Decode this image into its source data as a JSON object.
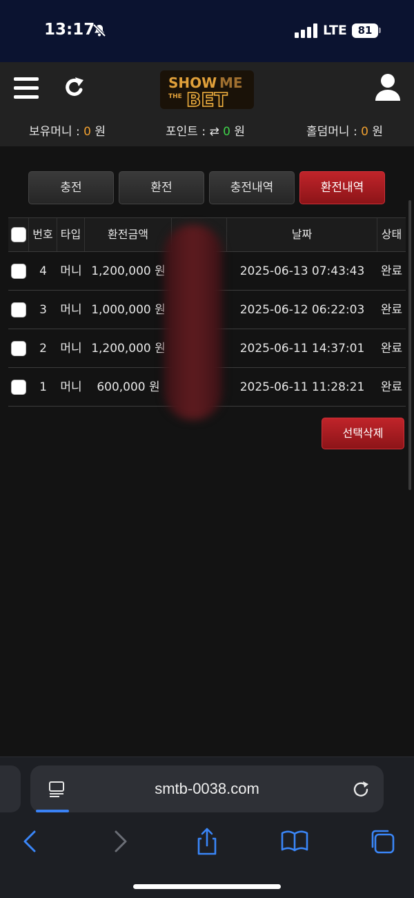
{
  "status_bar": {
    "time": "13:17",
    "network": "LTE",
    "battery": "81"
  },
  "header": {
    "logo_alt": "SHOW ME THE BET",
    "balances": [
      {
        "label": "보유머니 : ",
        "value": "0",
        "unit": " 원"
      },
      {
        "label": "포인트 : ",
        "value": "0",
        "unit": " 원"
      },
      {
        "label": "홀덤머니 : ",
        "value": "0",
        "unit": " 원"
      }
    ]
  },
  "tabs": [
    {
      "label": "충전",
      "active": false
    },
    {
      "label": "환전",
      "active": false
    },
    {
      "label": "충전내역",
      "active": false
    },
    {
      "label": "환전내역",
      "active": true
    }
  ],
  "table": {
    "columns": [
      "번호",
      "타입",
      "환전금액",
      "날짜",
      "상태"
    ],
    "rows": [
      {
        "no": "4",
        "type": "머니",
        "amount": "1,200,000 원",
        "date": "2025-06-13 07:43:43",
        "status": "완료"
      },
      {
        "no": "3",
        "type": "머니",
        "amount": "1,000,000 원",
        "date": "2025-06-12 06:22:03",
        "status": "완료"
      },
      {
        "no": "2",
        "type": "머니",
        "amount": "1,200,000 원",
        "date": "2025-06-11 14:37:01",
        "status": "완료"
      },
      {
        "no": "1",
        "type": "머니",
        "amount": "600,000 원",
        "date": "2025-06-11 11:28:21",
        "status": "완료"
      }
    ]
  },
  "actions": {
    "delete_selected": "선택삭제"
  },
  "browser": {
    "url": "smtb-0038.com"
  },
  "colors": {
    "accent_red": "#b01c22",
    "balance_orange": "#f0a030",
    "point_green": "#3fd14a"
  }
}
